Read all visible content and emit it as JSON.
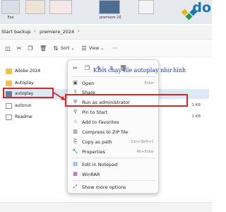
{
  "top_strip": {
    "thumbnails": [
      {
        "caption": "Exo"
      },
      {
        "caption": ""
      },
      {
        "caption": "premiere 20"
      },
      {
        "caption": ""
      }
    ],
    "logo_text": "do"
  },
  "address_bar": {
    "crumbs": [
      "Start backup",
      "premiere_2024"
    ]
  },
  "toolbar": {
    "sort_label": "Sort",
    "view_label": "View"
  },
  "files": [
    {
      "name": "Adobe 2024",
      "type": "folder",
      "size": ""
    },
    {
      "name": "Autoplay",
      "type": "folder",
      "size": ""
    },
    {
      "name": "autoplay",
      "type": "app",
      "size": "",
      "selected": true
    },
    {
      "name": "autorun",
      "type": "file",
      "size": "1 KB"
    },
    {
      "name": "Readme",
      "type": "file",
      "size": "1 KB"
    }
  ],
  "context_menu": {
    "items": [
      {
        "label": "Open",
        "shortcut": "Enter",
        "icon": "open-icon"
      },
      {
        "label": "Share",
        "shortcut": "",
        "icon": "share-icon"
      },
      {
        "label": "Run as administrator",
        "shortcut": "",
        "icon": "shield-icon"
      },
      {
        "label": "Pin to Start",
        "shortcut": "",
        "icon": "pin-icon"
      },
      {
        "label": "Add to Favorites",
        "shortcut": "",
        "icon": "star-icon"
      },
      {
        "label": "Compress to ZIP file",
        "shortcut": "",
        "icon": "zip-icon"
      },
      {
        "label": "Copy as path",
        "shortcut": "Ctrl+Shift+C",
        "icon": "path-icon"
      },
      {
        "label": "Properties",
        "shortcut": "Alt+Enter",
        "icon": "wrench-icon"
      },
      {
        "label": "Edit in Notepad",
        "shortcut": "",
        "icon": "notepad-icon"
      },
      {
        "label": "WinRAR",
        "shortcut": "",
        "icon": "winrar-icon"
      },
      {
        "label": "Show more options",
        "shortcut": "",
        "icon": "more-options-icon"
      }
    ]
  },
  "annotation": {
    "text": "Khởi chạy file autoplay như hình",
    "color": "#1b2fd8",
    "highlight_color": "#d7262b"
  }
}
